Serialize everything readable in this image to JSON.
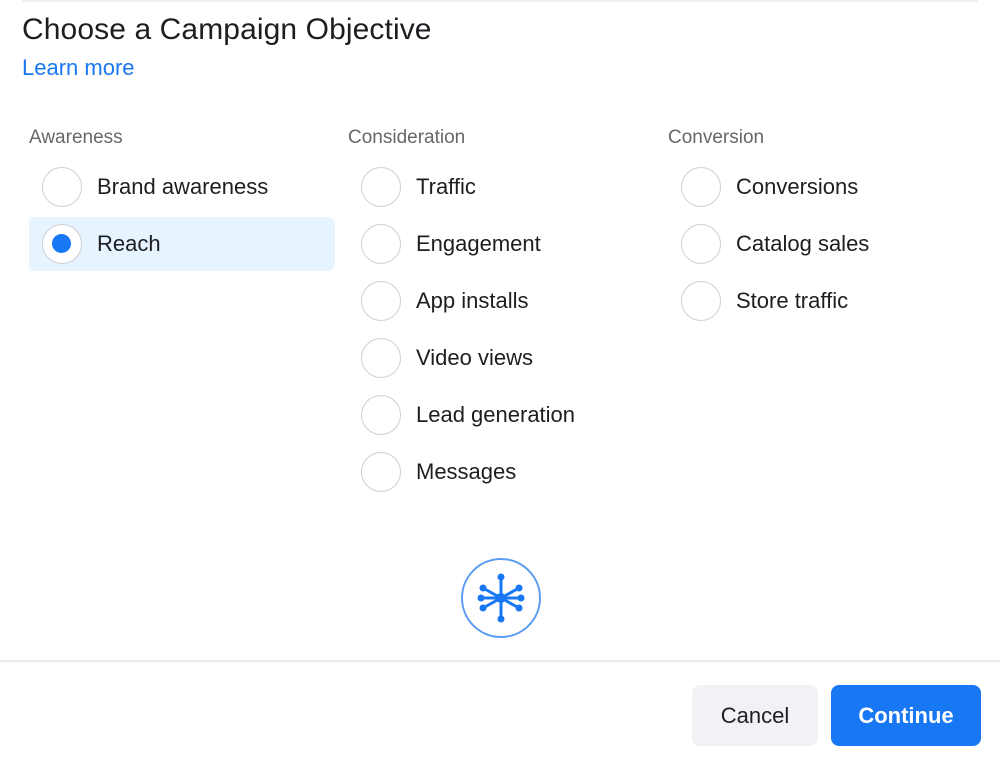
{
  "header": {
    "title": "Choose a Campaign Objective",
    "learn_more": "Learn more"
  },
  "columns": [
    {
      "heading": "Awareness",
      "options": [
        {
          "label": "Brand awareness",
          "selected": false
        },
        {
          "label": "Reach",
          "selected": true
        }
      ]
    },
    {
      "heading": "Consideration",
      "options": [
        {
          "label": "Traffic",
          "selected": false
        },
        {
          "label": "Engagement",
          "selected": false
        },
        {
          "label": "App installs",
          "selected": false
        },
        {
          "label": "Video views",
          "selected": false
        },
        {
          "label": "Lead generation",
          "selected": false
        },
        {
          "label": "Messages",
          "selected": false
        }
      ]
    },
    {
      "heading": "Conversion",
      "options": [
        {
          "label": "Conversions",
          "selected": false
        },
        {
          "label": "Catalog sales",
          "selected": false
        },
        {
          "label": "Store traffic",
          "selected": false
        }
      ]
    }
  ],
  "illustration": {
    "icon": "reach-network-icon",
    "color": "#1877f2"
  },
  "footer": {
    "cancel_label": "Cancel",
    "continue_label": "Continue"
  },
  "colors": {
    "accent": "#1877f2",
    "selected_bg": "#e7f3ff"
  }
}
